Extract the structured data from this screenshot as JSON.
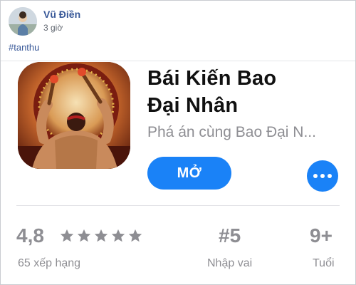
{
  "post": {
    "author": "Vũ Điền",
    "time": "3 giờ",
    "hashtag": "#tanthu"
  },
  "app": {
    "title_line1": "Bái Kiến Bao",
    "title_line2": "Đại Nhân",
    "subtitle": "Phá án cùng Bao Đại N...",
    "get_label": "MỞ",
    "more_icon": "ellipsis-icon",
    "accent_color": "#1a82f7"
  },
  "stats": {
    "rating": "4,8",
    "stars": 5,
    "rating_count": "65 xếp hạng",
    "rank": "#5",
    "rank_category": "Nhập vai",
    "age": "9+",
    "age_label": "Tuổi"
  }
}
